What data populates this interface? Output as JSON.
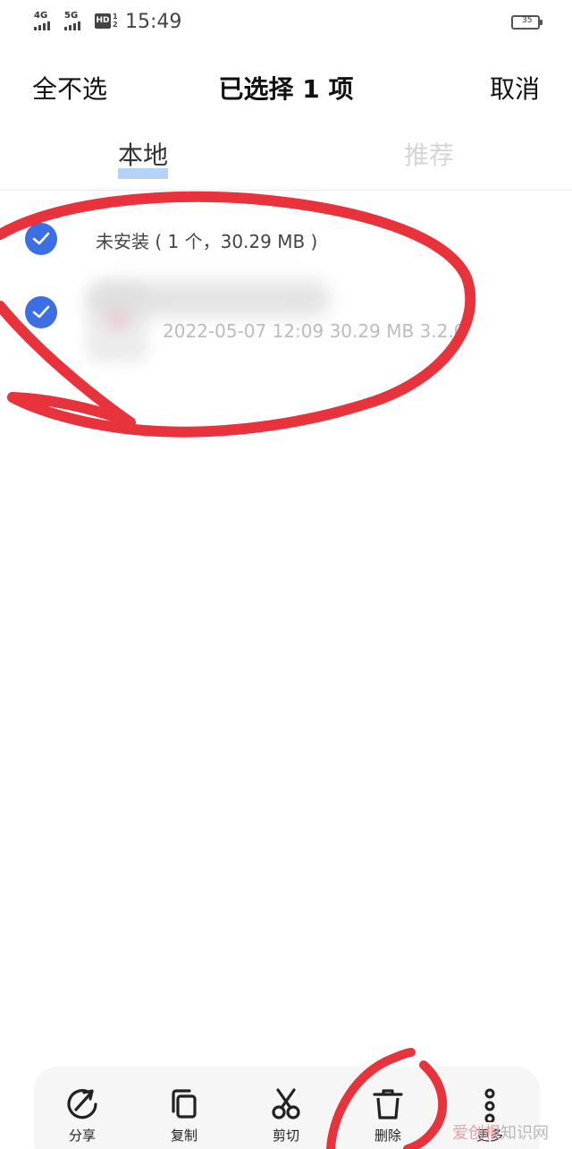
{
  "status_bar": {
    "signal1_label": "4G",
    "signal2_label": "5G",
    "hd_label": "HD",
    "hd_sub_top": "1",
    "hd_sub_bottom": "2",
    "time": "15:49",
    "battery": "35"
  },
  "header": {
    "deselect_all": "全不选",
    "title": "已选择 1 项",
    "cancel": "取消"
  },
  "tabs": [
    {
      "label": "本地",
      "active": true
    },
    {
      "label": "推荐",
      "active": false
    }
  ],
  "list": {
    "group_label": "未安装 ( 1 个，30.29 MB )",
    "file_meta": "2022-05-07 12:09  30.29 MB  3.2.0"
  },
  "toolbar": {
    "share": "分享",
    "copy": "复制",
    "cut": "剪切",
    "delete": "删除",
    "more": "更多"
  },
  "watermark": {
    "part_a": "爱创根",
    "part_b": "知识网"
  },
  "colors": {
    "accent": "#3c6ee6",
    "tab_underline": "#b6d3f5",
    "annotation": "#e8333c"
  }
}
